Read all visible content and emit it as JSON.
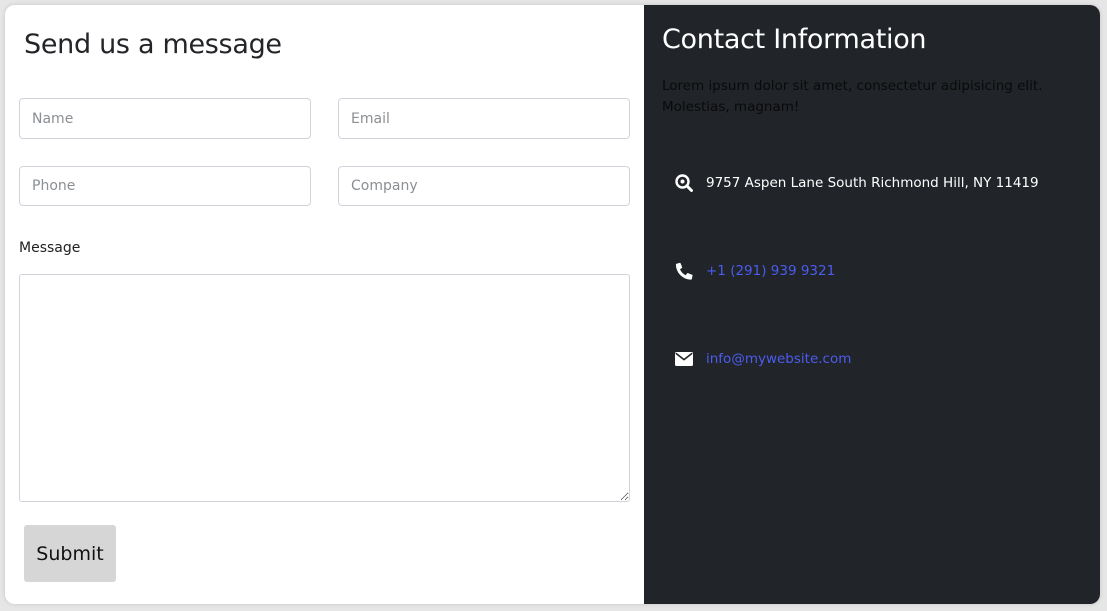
{
  "form": {
    "title": "Send us a message",
    "fields": {
      "name_placeholder": "Name",
      "email_placeholder": "Email",
      "phone_placeholder": "Phone",
      "company_placeholder": "Company"
    },
    "message_label": "Message",
    "message_value": "",
    "submit_label": "Submit"
  },
  "contact": {
    "title": "Contact Information",
    "description": "Lorem ipsum dolor sit amet, consectetur adipisicing elit. Molestias, magnam!",
    "address": "9757 Aspen Lane South Richmond Hill, NY 11419",
    "phone": "+1 (291) 939 9321",
    "email": "info@mywebsite.com",
    "icons": {
      "address": "search-location-icon",
      "phone": "phone-icon",
      "email": "envelope-icon"
    }
  },
  "colors": {
    "panel_dark": "#212428",
    "link": "#4b5cf0",
    "button": "#d6d6d6"
  }
}
